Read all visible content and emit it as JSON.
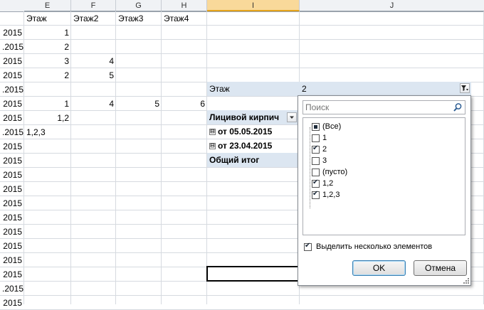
{
  "columns": [
    {
      "label": "E",
      "selected": false
    },
    {
      "label": "F",
      "selected": false
    },
    {
      "label": "G",
      "selected": false
    },
    {
      "label": "H",
      "selected": false
    },
    {
      "label": "I",
      "selected": true
    },
    {
      "label": "J",
      "selected": false
    }
  ],
  "rows": [
    {
      "d": "",
      "e": "Этаж",
      "f": "Этаж2",
      "g": "Этаж3",
      "h": "Этаж4"
    },
    {
      "d": "2015",
      "e": "1",
      "f": "",
      "g": "",
      "h": ""
    },
    {
      "d": ".2015",
      "e": "2",
      "f": "",
      "g": "",
      "h": ""
    },
    {
      "d": "2015",
      "e": "3",
      "f": "4",
      "g": "",
      "h": ""
    },
    {
      "d": "2015",
      "e": "2",
      "f": "5",
      "g": "",
      "h": ""
    },
    {
      "d": ".2015",
      "e": "",
      "f": "",
      "g": "",
      "h": ""
    },
    {
      "d": "2015",
      "e": "1",
      "f": "4",
      "g": "5",
      "h": "6"
    },
    {
      "d": "2015",
      "e": "1,2",
      "f": "",
      "g": "",
      "h": ""
    },
    {
      "d": ".2015",
      "e": "1,2,3",
      "f": "",
      "g": "",
      "h": ""
    },
    {
      "d": "2015",
      "e": "",
      "f": "",
      "g": "",
      "h": ""
    },
    {
      "d": "2015",
      "e": "",
      "f": "",
      "g": "",
      "h": ""
    },
    {
      "d": "2015",
      "e": "",
      "f": "",
      "g": "",
      "h": ""
    },
    {
      "d": "2015",
      "e": "",
      "f": "",
      "g": "",
      "h": ""
    },
    {
      "d": "2015",
      "e": "",
      "f": "",
      "g": "",
      "h": ""
    },
    {
      "d": "2015",
      "e": "",
      "f": "",
      "g": "",
      "h": ""
    },
    {
      "d": "2015",
      "e": "",
      "f": "",
      "g": "",
      "h": ""
    },
    {
      "d": "2015",
      "e": "",
      "f": "",
      "g": "",
      "h": ""
    },
    {
      "d": "2015",
      "e": "",
      "f": "",
      "g": "",
      "h": ""
    },
    {
      "d": "2015",
      "e": "",
      "f": "",
      "g": "",
      "h": ""
    },
    {
      "d": ".2015",
      "e": "",
      "f": "",
      "g": "",
      "h": ""
    },
    {
      "d": "2015",
      "e": "",
      "f": "",
      "g": "",
      "h": ""
    }
  ],
  "pivot": {
    "filter_label": "Этаж",
    "filter_value": "2",
    "row_header": "Лицивой кирпич",
    "groups": [
      "от 05.05.2015",
      "от 23.04.2015"
    ],
    "grand_total": "Общий итог",
    "expander_symbol": "⊟"
  },
  "dropdown": {
    "search_placeholder": "Поиск",
    "items": [
      {
        "label": "(Все)",
        "state": "partial"
      },
      {
        "label": "1",
        "state": "off"
      },
      {
        "label": "2",
        "state": "on"
      },
      {
        "label": "3",
        "state": "off"
      },
      {
        "label": "(пусто)",
        "state": "off"
      },
      {
        "label": "1,2",
        "state": "on"
      },
      {
        "label": "1,2,3",
        "state": "on"
      }
    ],
    "multi_select_label": "Выделить несколько элементов",
    "multi_select_checked": true,
    "ok_label": "OK",
    "cancel_label": "Отмена"
  },
  "colors": {
    "pivot_band": "#dce6f1",
    "selected_column_header": "#f9d99a",
    "grid": "#d6dae0"
  }
}
